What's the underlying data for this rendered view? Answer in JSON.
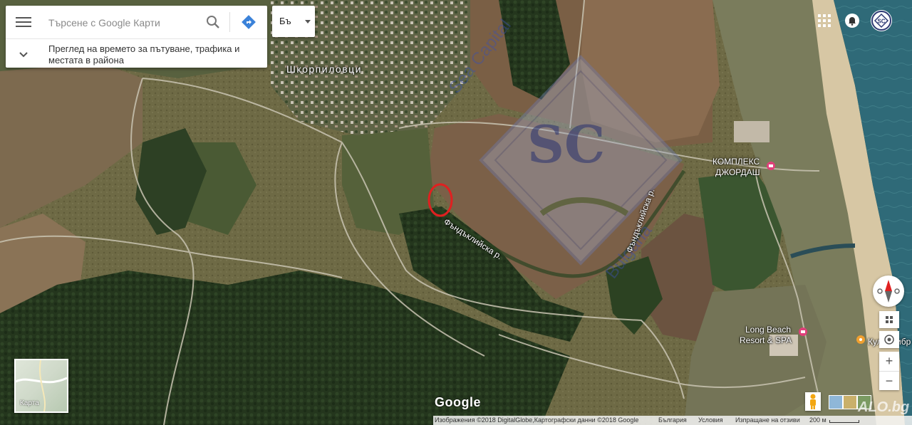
{
  "search": {
    "placeholder": "Търсене с Google Карти",
    "subtitle": "Преглед на времето за пътуване, трафика и местата в района"
  },
  "language": {
    "label": "Бъ"
  },
  "map": {
    "labels": {
      "village": "Шкорпиловци",
      "complex_line1": "КОМПЛЕКС",
      "complex_line2": "ДЖОРДАШ",
      "river1": "Фъндъклийска р.",
      "river2": "Фъндъклийска р.",
      "resort_line1": "Long Beach",
      "resort_line2": "Resort & SPA",
      "partial_poi": "Кул",
      "partial_poi2": "ибр"
    },
    "watermark": {
      "monogram": "SC",
      "text_top": "Sea Capital",
      "text_side": "Bulgaria"
    }
  },
  "controls": {
    "thumb_label": "Карта",
    "zoom_in": "+",
    "zoom_out": "−"
  },
  "brand": {
    "google": "Google"
  },
  "footer": {
    "imagery": "Изображения ©2018 DigitalGlobe,Картографски данни ©2018 Google",
    "country": "България",
    "terms": "Условия",
    "feedback": "Изпращане на отзиви",
    "scale": "200 м"
  },
  "overlay": {
    "site_watermark": "ALO.bg"
  },
  "colors": {
    "marker_ring": "#e02020",
    "poi_pink": "#e0407a",
    "poi_orange": "#f0a030"
  }
}
